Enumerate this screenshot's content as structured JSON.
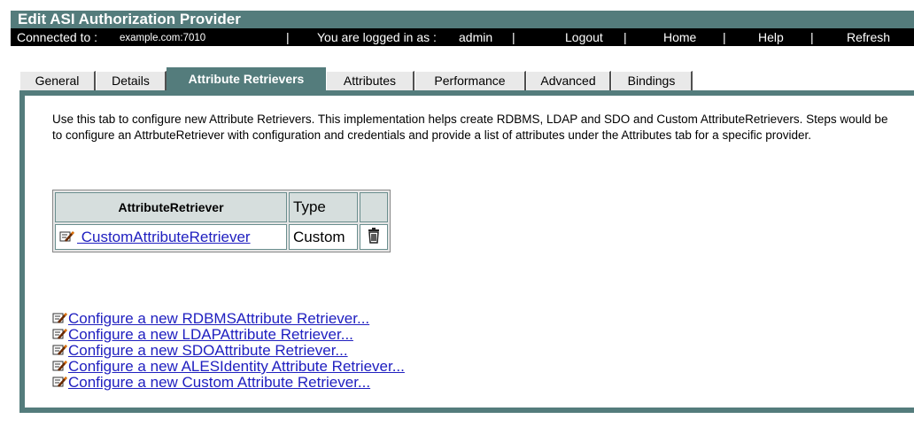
{
  "window": {
    "title": "Edit ASI Authorization Provider"
  },
  "connection": {
    "connected_label": "Connected to :",
    "host": "example.com:7010",
    "separator": "|",
    "logged_in_label": "You are logged in as :",
    "user": "admin",
    "logout": "Logout",
    "home": "Home",
    "help": "Help",
    "refresh": "Refresh"
  },
  "tabs": [
    {
      "label": "General",
      "active": false
    },
    {
      "label": "Details",
      "active": false
    },
    {
      "label": "Attribute Retrievers",
      "active": true
    },
    {
      "label": "Attributes",
      "active": false
    },
    {
      "label": "Performance",
      "active": false
    },
    {
      "label": "Advanced",
      "active": false
    },
    {
      "label": "Bindings",
      "active": false
    }
  ],
  "main": {
    "description": "Use this tab to configure new Attribute Retrievers. This implementation helps create RDBMS, LDAP and SDO and Custom AttributeRetrievers. Steps would be to configure an AttrbuteRetriever with configuration and credentials and provide a list of attributes under the Attributes tab for a specific provider.",
    "table": {
      "headers": [
        "AttributeRetriever",
        "Type",
        ""
      ],
      "rows": [
        {
          "name": " CustomAttributeRetriever",
          "type": "Custom"
        }
      ]
    },
    "links": [
      "Configure a new RDBMSAttribute Retriever...",
      "Configure a new LDAPAttribute Retriever...",
      "Configure a new SDOAttribute Retriever...",
      "Configure a new ALESIdentity Attribute Retriever...",
      "Configure a new Custom Attribute Retriever..."
    ]
  },
  "icons": {
    "edit": "pencil-edit-icon",
    "delete": "trash-icon"
  },
  "colors": {
    "accent": "#547c7c",
    "connbar": "#000000",
    "link": "#2020c0"
  }
}
